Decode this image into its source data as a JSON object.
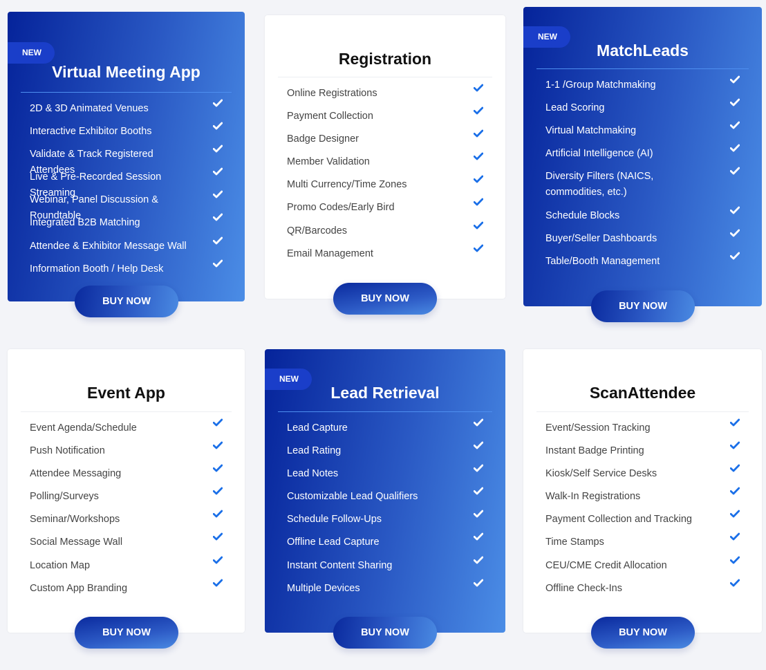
{
  "cards": [
    {
      "title": "Virtual Meeting App",
      "badge": "NEW",
      "style": "blue",
      "features": [
        "2D & 3D Animated Venues",
        "Interactive Exhibitor Booths",
        "Validate & Track Registered Attendees",
        "Live & Pre-Recorded Session Streaming",
        "Webinar, Panel Discussion & Roundtable",
        "Integrated B2B Matching",
        "Attendee & Exhibitor Message Wall",
        "Information Booth / Help Desk"
      ],
      "button": "BUY NOW"
    },
    {
      "title": "Registration",
      "style": "white",
      "features": [
        "Online Registrations",
        "Payment Collection",
        "Badge Designer",
        "Member Validation",
        "Multi Currency/Time Zones",
        "Promo Codes/Early Bird",
        "QR/Barcodes",
        "Email Management"
      ],
      "button": "BUY NOW"
    },
    {
      "title": "MatchLeads",
      "badge": "NEW",
      "style": "blue",
      "features": [
        "1-1 /Group Matchmaking",
        "Lead Scoring",
        "Virtual Matchmaking",
        "Artificial Intelligence (AI)",
        "Diversity Filters (NAICS, commodities, etc.)",
        "Schedule Blocks",
        "Buyer/Seller Dashboards",
        "Table/Booth Management"
      ],
      "button": "BUY NOW"
    },
    {
      "title": "Event App",
      "style": "white",
      "features": [
        "Event Agenda/Schedule",
        "Push Notification",
        "Attendee Messaging",
        "Polling/Surveys",
        "Seminar/Workshops",
        "Social Message Wall",
        "Location Map",
        "Custom App Branding"
      ],
      "button": "BUY NOW"
    },
    {
      "title": "Lead Retrieval",
      "badge": "NEW",
      "style": "blue",
      "features": [
        "Lead Capture",
        "Lead Rating",
        "Lead Notes",
        "Customizable Lead Qualifiers",
        "Schedule Follow-Ups",
        "Offline Lead Capture",
        "Instant Content Sharing",
        "Multiple Devices"
      ],
      "button": "BUY NOW"
    },
    {
      "title": "ScanAttendee",
      "style": "white",
      "features": [
        "Event/Session Tracking",
        "Instant Badge Printing",
        "Kiosk/Self Service Desks",
        "Walk-In Registrations",
        "Payment Collection and Tracking",
        "Time Stamps",
        "CEU/CME Credit Allocation",
        "Offline Check-Ins"
      ],
      "button": "BUY NOW"
    }
  ],
  "colors": {
    "check_on_white": "#1a6fe8",
    "check_on_blue": "#ffffff",
    "page_bg": "#f3f4f8"
  }
}
